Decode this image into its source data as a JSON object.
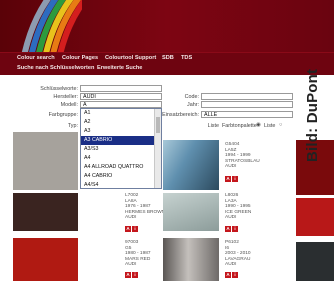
{
  "nav": {
    "row1": [
      "Colour search",
      "Colour Pages",
      "Colourtool Support",
      "SDB",
      "TDS"
    ],
    "row2": [
      "Suche nach Schlüsselworten",
      "Erweiterte Suche"
    ]
  },
  "form": {
    "left": [
      {
        "label": "Schlüsselworte:",
        "value": ""
      },
      {
        "label": "Hersteller:",
        "value": "AUDI"
      },
      {
        "label": "Modell:",
        "value": "A"
      },
      {
        "label": "Farbgruppe:",
        "value": ""
      },
      {
        "label": "Typ:",
        "value": ""
      }
    ],
    "right": [
      {
        "label": "Code:",
        "value": ""
      },
      {
        "label": "Jahr:",
        "value": ""
      },
      {
        "label": "Einsatzbereich:",
        "value": "ALLE"
      }
    ],
    "liste_label": "Liste",
    "liste_options": [
      "Farbtonpalette",
      "Liste"
    ]
  },
  "dropdown": {
    "options": [
      "A1",
      "A2",
      "A3",
      "A3 CABRIO",
      "A3/S3",
      "A4",
      "A4 ALLROAD QUATTRO",
      "A4 CABRIO",
      "A4/S4"
    ],
    "selected": "A3 CABRIO"
  },
  "swatches": [
    {
      "code": "G5404",
      "line2": "LA5Z",
      "years": "1994 - 1999",
      "name": "STRATOSBLAU",
      "brand": "AUDI",
      "color": "#5f8fae"
    },
    {
      "code": "L7002",
      "line2": "LA8A",
      "years": "1976 - 1987",
      "name": "HERMES BROWN",
      "brand": "AUDI",
      "color": "#3a2420"
    },
    {
      "code": "L8026",
      "line2": "LA3A",
      "years": "1990 - 1995",
      "name": "ICE GREEN",
      "brand": "AUDI",
      "color": "#9cacaa"
    },
    {
      "code": "97003",
      "line2": "G5",
      "years": "1980 - 1987",
      "name": "MARS RED",
      "brand": "AUDI",
      "color": "#b01a12"
    },
    {
      "code": "P6102",
      "line2": "I6",
      "years": "2003 - 2010",
      "name": "LAVAGRAU",
      "brand": "AUDI",
      "color": "#807c7a"
    }
  ],
  "icons": [
    "pdf-icon",
    "info-icon"
  ],
  "watermark": "Bild: DuPont",
  "colors": {
    "header": "#6e0410",
    "selection": "#1a2e86",
    "icon": "#c4161c"
  }
}
